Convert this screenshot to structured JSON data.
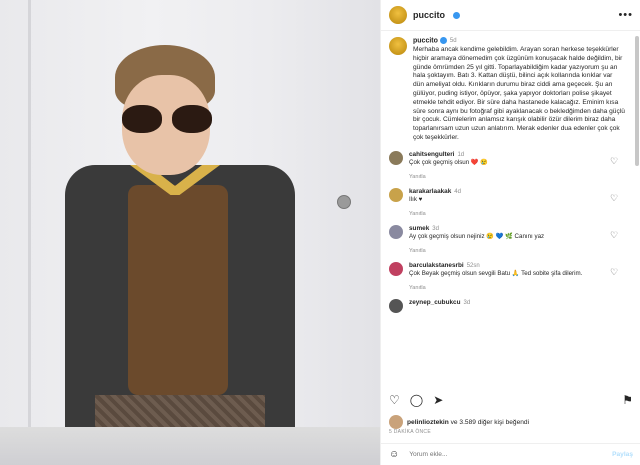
{
  "post": {
    "username": "puccito",
    "more": "•••",
    "caption_user": "puccito",
    "caption_age": "5d",
    "caption": "Merhaba ancak kendime gelebildim. Arayan soran herkese teşekkürler hiçbir aramaya dönemedim çok üzgünüm konuşacak halde değildim, bir günde ömrümden 25 yıl gitti. Toparlayabildiğim kadar yazıyorum şu an hala şoktayım. Batı 3. Kattan düştü, bilinci açık kollarında kırıklar var dün ameliyat oldu. Kırıkların durumu biraz ciddi ama geçecek. Şu an gülüyor, puding istiyor, öpüyor, şaka yapıyor doktorları polise şikayet etmekle tehdit ediyor. Bir süre daha hastanede kalacağız. Eminim kısa süre sonra aynı bu fotoğraf gibi ayaklanacak o bekledğimden daha güçlü bir çocuk. Cümlelerim anlamsız karışık olabilir özür dilerim biraz daha toparlanırsam uzun uzun anlatırım. Merak edenler dua edenler çok çok çok teşekkürler."
  },
  "comments": [
    {
      "user": "cahitsengulteri",
      "age": "1d",
      "text": "Çok çok geçmiş olsun ❤️ 😢",
      "reply": "Yanıtla",
      "color": "#8a7a5a"
    },
    {
      "user": "karakarlaakak",
      "age": "4d",
      "text": "Ilık ♥",
      "reply": "Yanıtla",
      "color": "#c8a24a"
    },
    {
      "user": "sumek",
      "age": "3d",
      "text": "Ay çok geçmiş olsun nejiniz 😢 💙 🌿 Canını yaz",
      "reply": "Yanıtla",
      "color": "#8a8aa0"
    },
    {
      "user": "barculakstanesrbi",
      "age": "52sn",
      "text": "Çok Beyak geçmiş olsun sevgili Batu 🙏 Ted sobite şifa dilerim.",
      "reply": "Yanıtla",
      "color": "#c04060"
    },
    {
      "user": "zeynep_cubukcu",
      "age": "3d",
      "text": "",
      "reply": "",
      "color": "#555555"
    }
  ],
  "likes": {
    "user": "pelinlioztekin",
    "text": "ve 3.589 diğer kişi beğendi"
  },
  "date": "5 DAKİKA ÖNCE",
  "add_comment": {
    "placeholder": "Yorum ekle...",
    "post": "Paylaş"
  },
  "colors": {
    "accent": "#3897f0",
    "muted": "#8e8e8e"
  }
}
